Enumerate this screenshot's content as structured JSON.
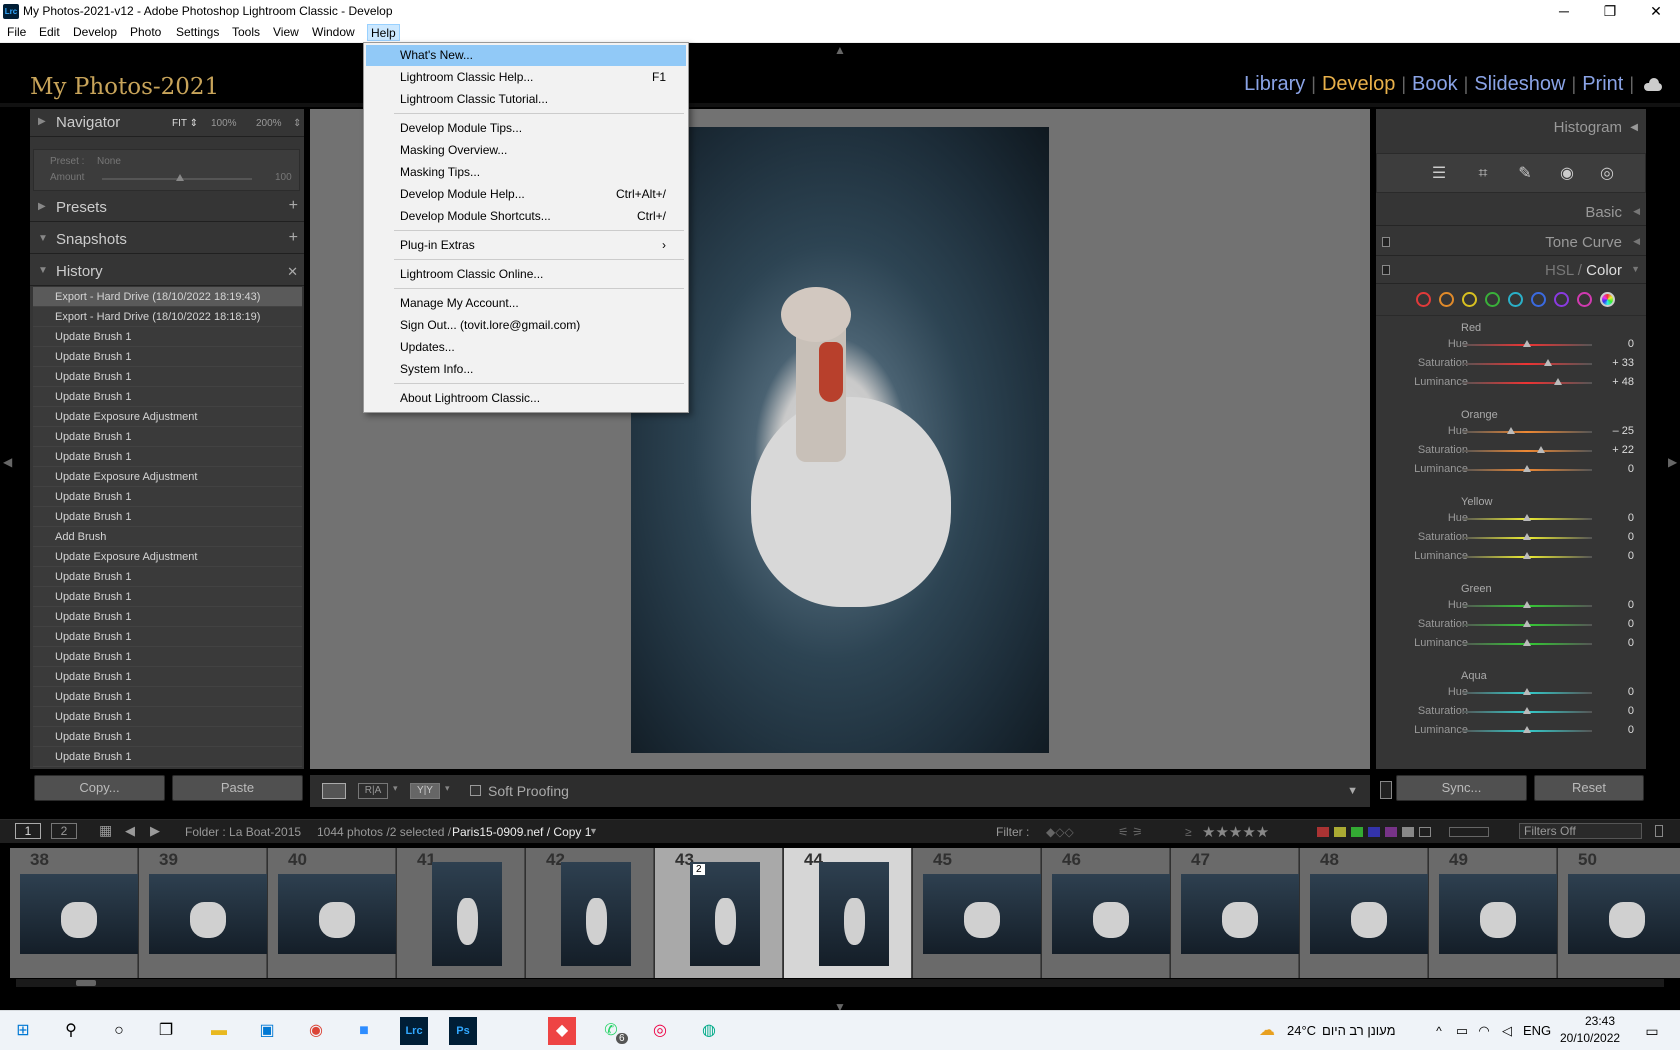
{
  "window": {
    "title": "My Photos-2021-v12 - Adobe Photoshop Lightroom Classic - Develop",
    "app_icon": "Lrc"
  },
  "menubar": [
    "File",
    "Edit",
    "Develop",
    "Photo",
    "Settings",
    "Tools",
    "View",
    "Window",
    "Help"
  ],
  "identity_plate": "My Photos-2021",
  "modules": [
    "Library",
    "Develop",
    "Book",
    "Slideshow",
    "Print"
  ],
  "active_module": "Develop",
  "help_menu": [
    {
      "label": "What's New...",
      "shortcut": ""
    },
    {
      "label": "Lightroom Classic Help...",
      "shortcut": "F1"
    },
    {
      "label": "Lightroom Classic Tutorial...",
      "shortcut": ""
    },
    {
      "label": "Develop Module Tips...",
      "shortcut": ""
    },
    {
      "label": "Masking Overview...",
      "shortcut": ""
    },
    {
      "label": "Masking Tips...",
      "shortcut": ""
    },
    {
      "label": "Develop Module Help...",
      "shortcut": "Ctrl+Alt+/"
    },
    {
      "label": "Develop Module Shortcuts...",
      "shortcut": "Ctrl+/"
    },
    {
      "label": "Plug-in Extras",
      "shortcut": "›"
    },
    {
      "label": "Lightroom Classic Online...",
      "shortcut": ""
    },
    {
      "label": "Manage My Account...",
      "shortcut": ""
    },
    {
      "label": "Sign Out... (tovit.lore@gmail.com)",
      "shortcut": ""
    },
    {
      "label": "Updates...",
      "shortcut": ""
    },
    {
      "label": "System Info...",
      "shortcut": ""
    },
    {
      "label": "About Lightroom Classic...",
      "shortcut": ""
    }
  ],
  "left_panel": {
    "navigator": {
      "label": "Navigator",
      "zoom_fit": "FIT ⇕",
      "zoom_100": "100%",
      "zoom_200": "200%",
      "zoom_menu": "⇕"
    },
    "preset_box": {
      "preset_label": "Preset :",
      "preset_value": "None",
      "amount_label": "Amount",
      "amount_value": "100"
    },
    "presets": "Presets",
    "snapshots": "Snapshots",
    "history": "History",
    "history_items": [
      "Export - Hard Drive (18/10/2022 18:19:43)",
      "Export - Hard Drive (18/10/2022 18:18:19)",
      "Update Brush 1",
      "Update Brush 1",
      "Update Brush 1",
      "Update Brush 1",
      "Update Exposure Adjustment",
      "Update Brush 1",
      "Update Brush 1",
      "Update Exposure Adjustment",
      "Update Brush 1",
      "Update Brush 1",
      "Add Brush",
      "Update Exposure Adjustment",
      "Update Brush 1",
      "Update Brush 1",
      "Update Brush 1",
      "Update Brush 1",
      "Update Brush 1",
      "Update Brush 1",
      "Update Brush 1",
      "Update Brush 1",
      "Update Brush 1",
      "Update Brush 1"
    ],
    "copy_button": "Copy...",
    "paste_button": "Paste"
  },
  "toolbar": {
    "soft_proofing": "Soft Proofing",
    "view_ra": "R|A",
    "view_yy": "Y|Y"
  },
  "right_panel": {
    "histogram": "Histogram",
    "basic": "Basic",
    "tone_curve": "Tone Curve",
    "hsl_label": "HSL",
    "hsl_sep": "/",
    "color_label": "Color",
    "color_dots": [
      "#e03a3a",
      "#e08a2a",
      "#d8c020",
      "#3ab03a",
      "#2ab0c8",
      "#3a6ae0",
      "#8a3ae0",
      "#d03ab0"
    ],
    "groups": [
      {
        "name": "Red",
        "rows": [
          {
            "label": "Hue",
            "value": "0",
            "level": 0
          },
          {
            "label": "Saturation",
            "value": "+ 33",
            "level": 33
          },
          {
            "label": "Luminance",
            "value": "+ 48",
            "level": 48
          }
        ]
      },
      {
        "name": "Orange",
        "rows": [
          {
            "label": "Hue",
            "value": "– 25",
            "level": -25
          },
          {
            "label": "Saturation",
            "value": "+ 22",
            "level": 22
          },
          {
            "label": "Luminance",
            "value": "0",
            "level": 0
          }
        ]
      },
      {
        "name": "Yellow",
        "rows": [
          {
            "label": "Hue",
            "value": "0",
            "level": 0
          },
          {
            "label": "Saturation",
            "value": "0",
            "level": 0
          },
          {
            "label": "Luminance",
            "value": "0",
            "level": 0
          }
        ]
      },
      {
        "name": "Green",
        "rows": [
          {
            "label": "Hue",
            "value": "0",
            "level": 0
          },
          {
            "label": "Saturation",
            "value": "0",
            "level": 0
          },
          {
            "label": "Luminance",
            "value": "0",
            "level": 0
          }
        ]
      },
      {
        "name": "Aqua",
        "rows": [
          {
            "label": "Hue",
            "value": "0",
            "level": 0
          },
          {
            "label": "Saturation",
            "value": "0",
            "level": 0
          },
          {
            "label": "Luminance",
            "value": "0",
            "level": 0
          }
        ]
      }
    ],
    "sync_button": "Sync...",
    "reset_button": "Reset"
  },
  "filmstrip_bar": {
    "page1": "1",
    "page2": "2",
    "folder": "Folder : La Boat-2015",
    "count": "1044 photos /2 selected /",
    "filename": "Paris15-0909.nef / Copy 1",
    "filter_label": "Filter :",
    "rating_op": "≥",
    "stars": "★★★★★",
    "filters_off": "Filters Off"
  },
  "filmstrip": [
    {
      "num": "38",
      "state": "normal"
    },
    {
      "num": "39",
      "state": "normal"
    },
    {
      "num": "40",
      "state": "normal"
    },
    {
      "num": "41",
      "state": "normal"
    },
    {
      "num": "42",
      "state": "normal"
    },
    {
      "num": "43",
      "state": "sel"
    },
    {
      "num": "44",
      "state": "cur"
    },
    {
      "num": "45",
      "state": "normal"
    },
    {
      "num": "46",
      "state": "normal"
    },
    {
      "num": "47",
      "state": "normal"
    },
    {
      "num": "48",
      "state": "normal"
    },
    {
      "num": "49",
      "state": "normal"
    },
    {
      "num": "50",
      "state": "normal"
    }
  ],
  "filmstrip_badge": "2",
  "taskbar": {
    "weather": "24°C",
    "weather_text": "מעונן רב היום",
    "lang": "ENG",
    "time": "23:43",
    "date": "20/10/2022",
    "whatsapp_badge": "6",
    "lrc": "Lrc",
    "ps": "Ps"
  }
}
